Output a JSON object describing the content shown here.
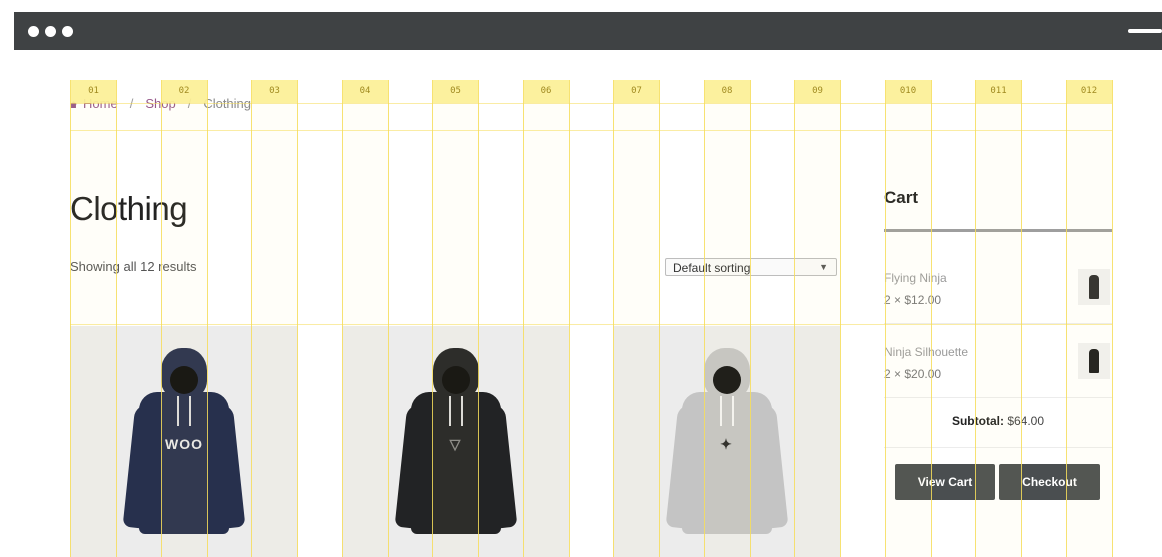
{
  "window": {
    "dots": 3
  },
  "breadcrumb": {
    "items": [
      "Home",
      "Shop",
      "Clothing"
    ],
    "separator": "/"
  },
  "page": {
    "title": "Clothing",
    "result_count": "Showing all 12 results"
  },
  "sort": {
    "selected": "Default sorting"
  },
  "products": [
    {
      "color": "#27304d",
      "logo": "WOO"
    },
    {
      "color": "#222325",
      "logo": ""
    },
    {
      "color": "#c4c4c4",
      "logo": ""
    }
  ],
  "cart": {
    "title": "Cart",
    "items": [
      {
        "name": "Flying Ninja",
        "qty": "2 × $12.00"
      },
      {
        "name": "Ninja Silhouette",
        "qty": "2 × $20.00"
      }
    ],
    "subtotal_label": "Subtotal:",
    "subtotal_value": "$64.00",
    "view_cart": "View Cart",
    "checkout": "Checkout"
  },
  "grid": {
    "labels": [
      "01",
      "02",
      "03",
      "04",
      "05",
      "06",
      "07",
      "08",
      "09",
      "010",
      "011",
      "012"
    ]
  },
  "colors": {
    "topbar": "#3f4244",
    "accent": "#96588a",
    "grid": "#f6dd5a",
    "button": "#4a4e50"
  }
}
